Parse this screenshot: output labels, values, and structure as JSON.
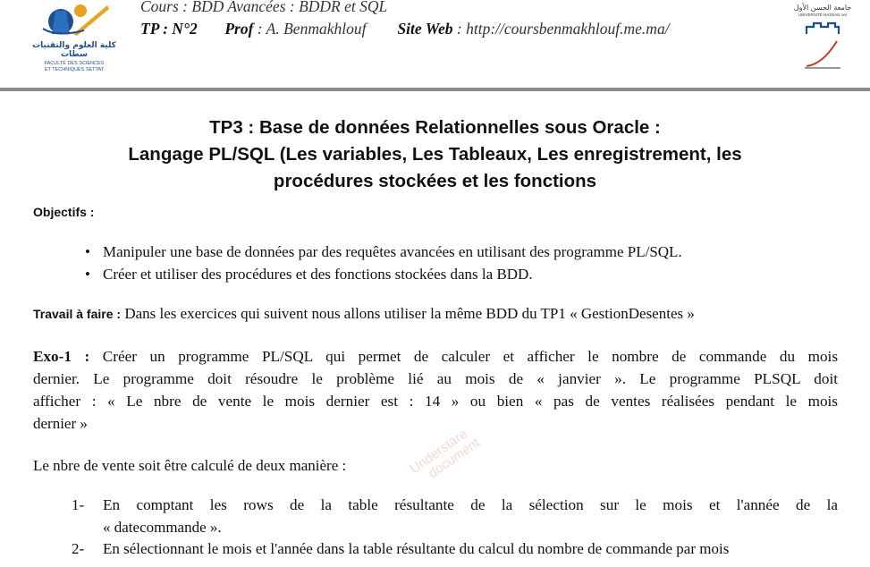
{
  "header": {
    "course_label": "Cours :",
    "course_value": "BDD Avancées : BDDR et SQL",
    "tp_label": "TP : N°2",
    "prof_label": "Prof",
    "prof_value": ": A. Benmakhlouf",
    "site_label": "Site Web",
    "site_value": ": http://coursbenmakhlouf.me.ma/",
    "logo_left_ar": "كلية العلوم والتقنيات سطات",
    "logo_left_fr1": "FACULTÉ DES SCIENCES",
    "logo_left_fr2": "ET TECHNIQUES SETTAT",
    "logo_right_ar": "جامعة الحسن الأول",
    "logo_right_fr": "UNIVERSITÉ HASSAN 1er"
  },
  "title": {
    "line1": "TP3 : Base de données Relationnelles sous Oracle :",
    "line2": "Langage PL/SQL (Les variables, Les Tableaux, Les enregistrement, les",
    "line3": "procédures stockées et les fonctions"
  },
  "objectifs_label": "Objectifs :",
  "objectifs": [
    "Manipuler une base de données par des requêtes avancées en utilisant des programme PL/SQL.",
    "Créer et utiliser des procédures et des fonctions stockées dans la BDD."
  ],
  "travail": {
    "label": "Travail à faire :",
    "text": " Dans les exercices qui suivent nous allons utiliser la même BDD du TP1 « GestionDesentes »"
  },
  "exo1": {
    "label": "Exo-1 :",
    "line1": "Créer un programme PL/SQL qui permet de calculer et afficher le nombre de commande du mois",
    "line2": "dernier. Le programme doit résoudre le problème lié au mois de « janvier ». Le programme PLSQL doit",
    "line3": "afficher : « Le nbre de vente le mois dernier est : 14 » ou bien « pas de ventes réalisées pendant le mois",
    "line4": "dernier »"
  },
  "calc_intro": "Le nbre de vente soit être calculé de deux manière :",
  "steps": [
    {
      "num": "1-",
      "line1": "En comptant les rows de la table résultante de la sélection sur le mois et l'année de la",
      "line2": "« datecommande »."
    },
    {
      "num": "2-",
      "line1": "En sélectionnant le mois et l'année dans la table résultante du calcul du nombre de commande par mois"
    }
  ],
  "watermark": {
    "line1": "Understare",
    "line2": "document"
  },
  "colors": {
    "separator": "#8a8a8a",
    "watermark": "#c8785a",
    "logo_blue": "#1f4e8c",
    "logo_orange": "#e8a321",
    "logo_red": "#c0392b"
  }
}
